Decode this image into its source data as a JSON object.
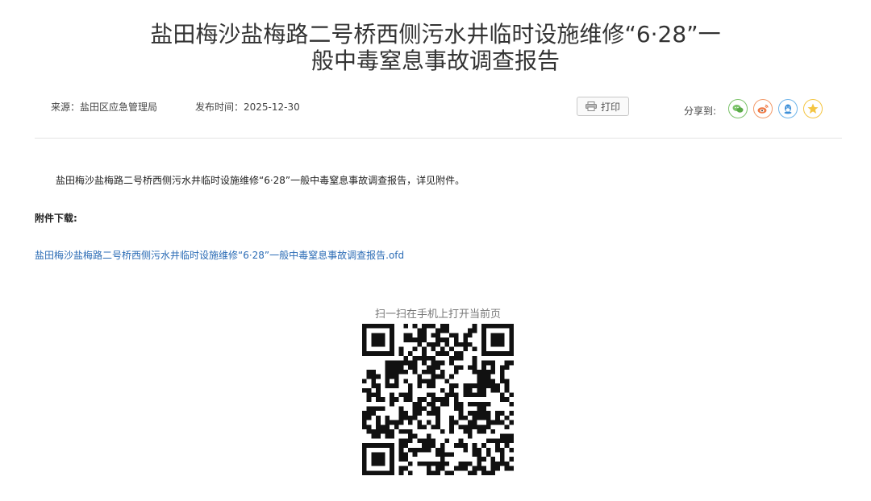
{
  "article": {
    "title_line1": "盐田梅沙盐梅路二号桥西侧污水井临时设施维修“6·28”一",
    "title_line2": "般中毒窒息事故调查报告",
    "source": "来源：盐田区应急管理局",
    "publish_date": "发布时间：2025-12-30",
    "body": "盐田梅沙盐梅路二号桥西侧污水井临时设施维修“6·28”一般中毒窒息事故调查报告，详见附件。"
  },
  "toolbar": {
    "print_label": "打印",
    "share_label": "分享到:",
    "share_icons": [
      "wechat-icon",
      "weibo-icon",
      "qq-icon",
      "qzone-icon"
    ]
  },
  "attachments": {
    "title": "附件下载:",
    "file_name": "盐田梅沙盐梅路二号桥西侧污水井临时设施维修“6·28”一般中毒窒息事故调查报告.ofd"
  },
  "qr": {
    "caption": "扫一扫在手机上打开当前页"
  },
  "colors": {
    "link": "#2a6bb5",
    "wechat": "#7bc36a",
    "weibo": "#f29a6a",
    "qq": "#6fb5ea",
    "qzone": "#f4c542"
  }
}
